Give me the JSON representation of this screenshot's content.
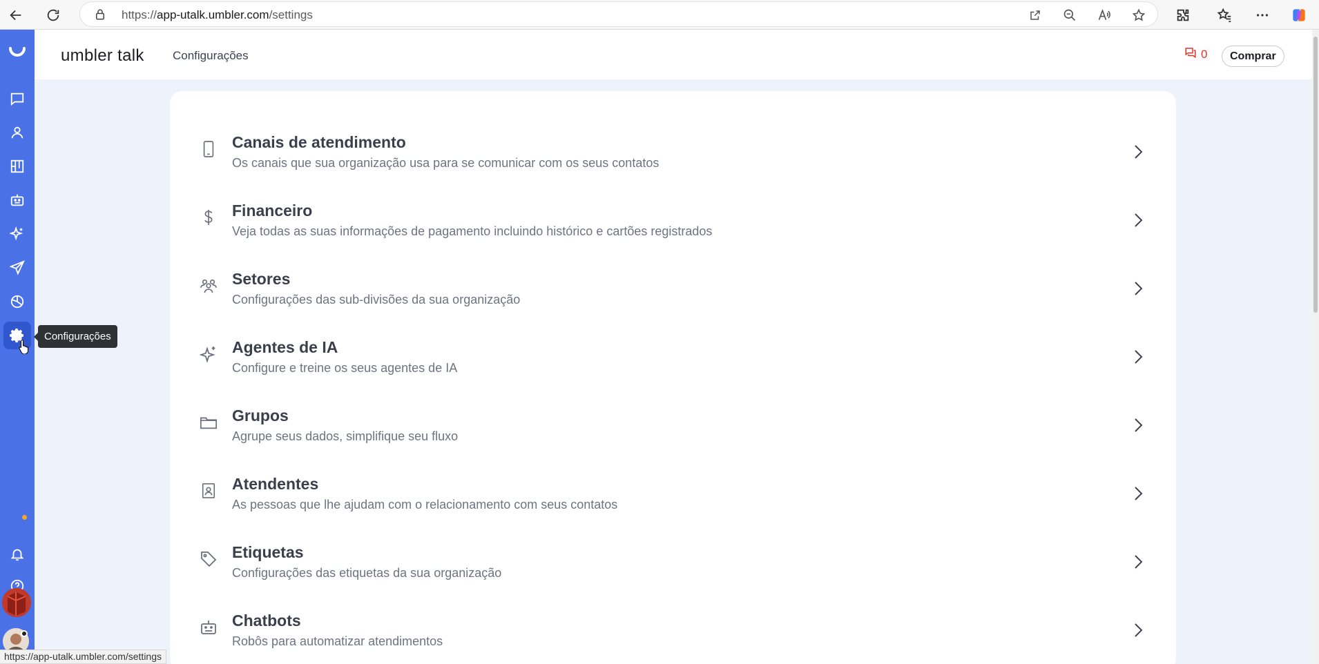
{
  "browser": {
    "url_prefix": "https://",
    "url_domain": "app-utalk.umbler.com",
    "url_path": "/settings",
    "status_url": "https://app-utalk.umbler.com/settings"
  },
  "header": {
    "logo": "umbler talk",
    "title": "Configurações",
    "message_count": "0",
    "buy_label": "Comprar"
  },
  "sidebar": {
    "tooltip": "Configurações",
    "items": [
      {
        "icon": "chat-icon"
      },
      {
        "icon": "contacts-icon"
      },
      {
        "icon": "kanban-icon"
      },
      {
        "icon": "bot-icon"
      },
      {
        "icon": "sparkle-icon"
      },
      {
        "icon": "send-icon"
      },
      {
        "icon": "reports-icon"
      },
      {
        "icon": "gear-icon",
        "active": true
      }
    ]
  },
  "settings": [
    {
      "icon": "phone-icon",
      "title": "Canais de atendimento",
      "description": "Os canais que sua organização usa para se comunicar com os seus contatos"
    },
    {
      "icon": "dollar-icon",
      "title": "Financeiro",
      "description": "Veja todas as suas informações de pagamento incluindo histórico e cartões registrados"
    },
    {
      "icon": "team-icon",
      "title": "Setores",
      "description": "Configurações das sub-divisões da sua organização"
    },
    {
      "icon": "sparkle-icon",
      "title": "Agentes de IA",
      "description": "Configure e treine os seus agentes de IA"
    },
    {
      "icon": "folder-icon",
      "title": "Grupos",
      "description": "Agrupe seus dados, simplifique seu fluxo"
    },
    {
      "icon": "badge-icon",
      "title": "Atendentes",
      "description": "As pessoas que lhe ajudam com o relacionamento com seus contatos"
    },
    {
      "icon": "tag-icon",
      "title": "Etiquetas",
      "description": "Configurações das etiquetas da sua organização"
    },
    {
      "icon": "bot-icon",
      "title": "Chatbots",
      "description": "Robôs para automatizar atendimentos"
    }
  ],
  "colors": {
    "rail": "#4a71e6",
    "accent_red": "#e0342b",
    "page_bg": "#eef2fb"
  }
}
